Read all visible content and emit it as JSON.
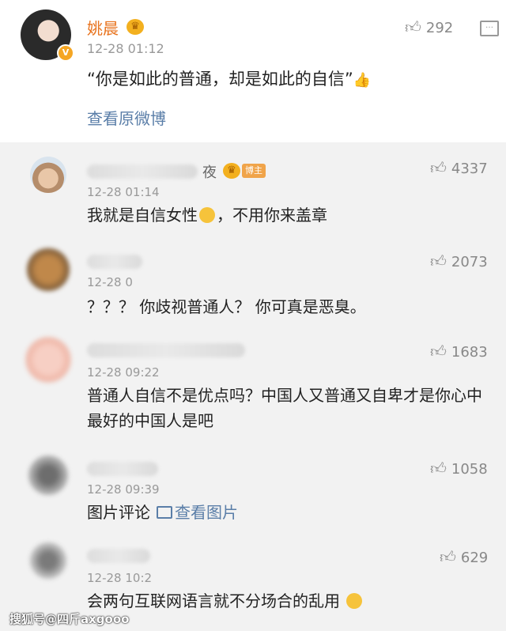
{
  "post": {
    "author": "姚晨",
    "time": "12-28 01:12",
    "text": "“你是如此的普通，却是如此的自信”",
    "thumb_emoji": "👍",
    "view_original": "查看原微博",
    "likes": "292",
    "v_badge": "V"
  },
  "comments": [
    {
      "name_suffix": "夜",
      "badge": "博主",
      "time": "12-28 01:14",
      "text_a": "我就是自信女性",
      "text_b": "，不用你来盖章",
      "likes": "4337"
    },
    {
      "time": "12-28 0",
      "text": "？？？ 你歧视普通人？ 你可真是恶臭。",
      "likes": "2073"
    },
    {
      "time": "12-28 09:22",
      "text": "普通人自信不是优点吗？中国人又普通又自卑才是你心中最好的中国人是吧",
      "likes": "1683"
    },
    {
      "time": "12-28 09:39",
      "text": "图片评论",
      "link": "查看图片",
      "likes": "1058"
    },
    {
      "time": "12-28 10:2",
      "text": "会两句互联网语言就不分场合的乱用",
      "likes": "629"
    }
  ],
  "watermark": "搜狐号@四斤axgooo",
  "icons": {
    "like": "thumbs-up-icon",
    "comment": "comment-icon",
    "crown": "crown-icon"
  }
}
